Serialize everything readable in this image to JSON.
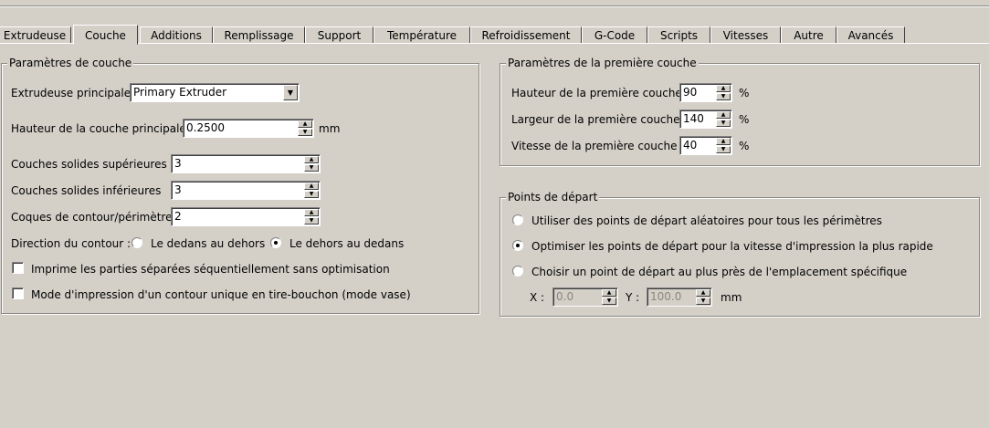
{
  "tabs": [
    {
      "label": "Extrudeuse",
      "active": false
    },
    {
      "label": "Couche",
      "active": true
    },
    {
      "label": "Additions",
      "active": false
    },
    {
      "label": "Remplissage",
      "active": false
    },
    {
      "label": "Support",
      "active": false
    },
    {
      "label": "Température",
      "active": false
    },
    {
      "label": "Refroidissement",
      "active": false
    },
    {
      "label": "G-Code",
      "active": false
    },
    {
      "label": "Scripts",
      "active": false
    },
    {
      "label": "Vitesses",
      "active": false
    },
    {
      "label": "Autre",
      "active": false
    },
    {
      "label": "Avancés",
      "active": false
    }
  ],
  "layer": {
    "title": "Paramètres de couche",
    "main_extruder_label": "Extrudeuse principale",
    "main_extruder_value": "Primary Extruder",
    "layer_height_label": "Hauteur de la couche principale",
    "layer_height_value": "0.2500",
    "layer_height_unit": "mm",
    "top_solid_label": "Couches solides supérieures",
    "top_solid_value": "3",
    "bottom_solid_label": "Couches solides inférieures",
    "bottom_solid_value": "3",
    "perimeters_label": "Coques de contour/périmètre",
    "perimeters_value": "2",
    "direction_label": "Direction du contour :",
    "direction_inside_out": "Le dedans au dehors",
    "direction_outside_in": "Le dehors au dedans",
    "direction_selected": "outside_in",
    "sequential_label": "Imprime les parties séparées séquentiellement sans optimisation",
    "sequential_checked": false,
    "vase_label": "Mode d'impression d'un contour unique en tire-bouchon (mode vase)",
    "vase_checked": false
  },
  "first_layer": {
    "title": "Paramètres de la première couche",
    "height_label": "Hauteur de la première couche",
    "height_value": "90",
    "width_label": "Largeur de la première couche",
    "width_value": "140",
    "speed_label": "Vitesse de la première couche",
    "speed_value": "40",
    "unit": "%"
  },
  "start_points": {
    "title": "Points de départ",
    "option_random": "Utiliser des points de départ aléatoires pour tous les périmètres",
    "option_optimize": "Optimiser les points de départ pour la vitesse d'impression la plus rapide",
    "option_specific": "Choisir un point de départ au plus près de l'emplacement spécifique",
    "selected": "optimize",
    "x_label": "X :",
    "x_value": "0.0",
    "y_label": "Y :",
    "y_value": "100.0",
    "unit": "mm"
  }
}
